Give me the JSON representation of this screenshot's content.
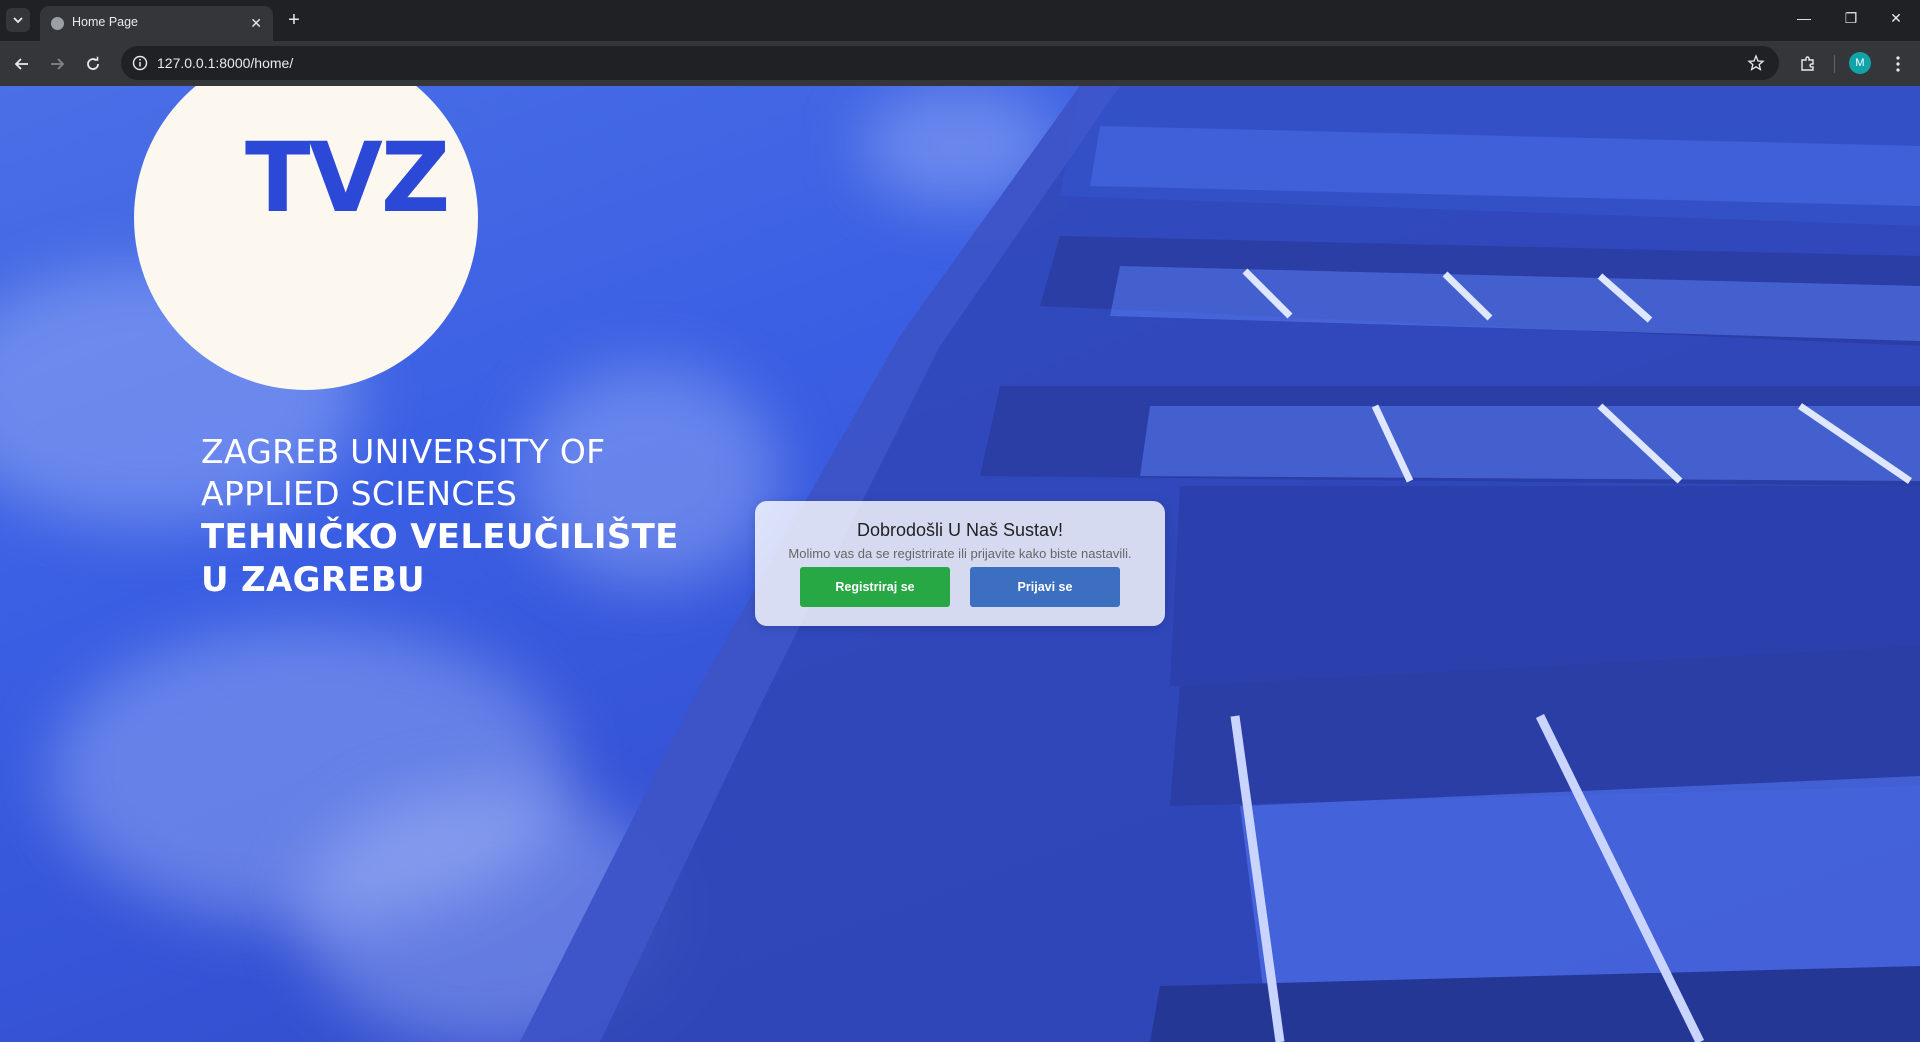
{
  "browser": {
    "tab_title": "Home Page",
    "tab_close": "✕",
    "new_tab": "+",
    "url": "127.0.0.1:8000/home/",
    "profile_initial": "M",
    "window_controls": {
      "minimize": "—",
      "restore": "❐",
      "close": "✕"
    }
  },
  "hero": {
    "logo_text": "TVZ",
    "lines": [
      "ZAGREB UNIVERSITY OF",
      "APPLIED SCIENCES",
      "TEHNIČKO VELEUČILIŠTE",
      "U ZAGREBU"
    ]
  },
  "card": {
    "title": "Dobrodošli U Naš Sustav!",
    "subtitle": "Molimo vas da se registrirate ili prijavite kako biste nastavili.",
    "register_label": "Registriraj se",
    "login_label": "Prijavi se"
  },
  "colors": {
    "register": "#28a745",
    "login": "#3d6fc0",
    "logo": "#2b49d6",
    "background": "#3a5ee3"
  }
}
